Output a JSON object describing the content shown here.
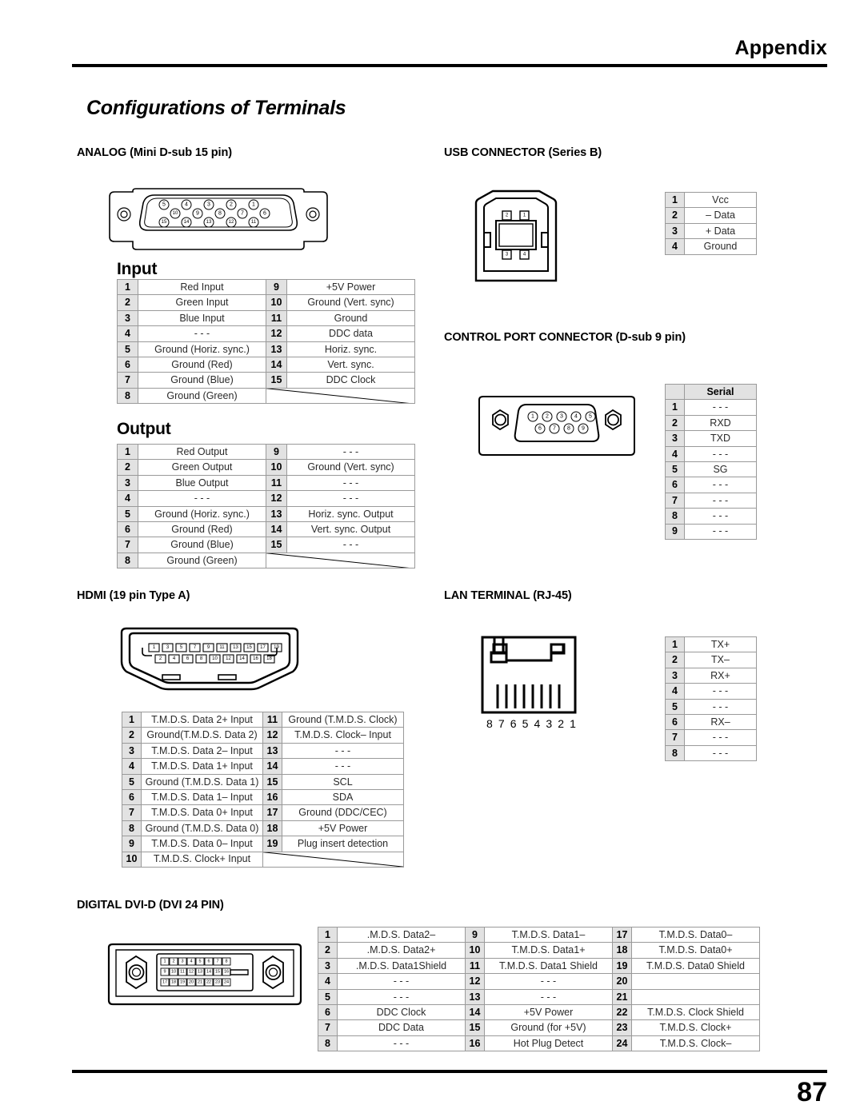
{
  "header": {
    "appendix_title": "Appendix",
    "section_title": "Configurations of Terminals",
    "page_number": "87"
  },
  "sections": {
    "analog": {
      "heading": "ANALOG (Mini D-sub 15 pin)"
    },
    "usb": {
      "heading": "USB CONNECTOR (Series B)"
    },
    "control_port": {
      "heading": "CONTROL PORT CONNECTOR (D-sub 9 pin)"
    },
    "hdmi": {
      "heading": "HDMI (19 pin Type A)"
    },
    "lan": {
      "heading": "LAN TERMINAL (RJ-45)"
    },
    "dvi": {
      "heading": "DIGITAL DVI-D (DVI 24 PIN)"
    }
  },
  "analog_input": {
    "title": "Input",
    "left": [
      {
        "pin": "1",
        "signal": "Red Input"
      },
      {
        "pin": "2",
        "signal": "Green Input"
      },
      {
        "pin": "3",
        "signal": "Blue Input"
      },
      {
        "pin": "4",
        "signal": "- - -"
      },
      {
        "pin": "5",
        "signal": "Ground (Horiz. sync.)"
      },
      {
        "pin": "6",
        "signal": "Ground (Red)"
      },
      {
        "pin": "7",
        "signal": "Ground (Blue)"
      },
      {
        "pin": "8",
        "signal": "Ground (Green)"
      }
    ],
    "right": [
      {
        "pin": "9",
        "signal": "+5V Power"
      },
      {
        "pin": "10",
        "signal": "Ground (Vert. sync)"
      },
      {
        "pin": "11",
        "signal": "Ground"
      },
      {
        "pin": "12",
        "signal": "DDC data"
      },
      {
        "pin": "13",
        "signal": "Horiz. sync."
      },
      {
        "pin": "14",
        "signal": "Vert. sync."
      },
      {
        "pin": "15",
        "signal": "DDC Clock"
      }
    ]
  },
  "analog_output": {
    "title": "Output",
    "left": [
      {
        "pin": "1",
        "signal": "Red Output"
      },
      {
        "pin": "2",
        "signal": "Green Output"
      },
      {
        "pin": "3",
        "signal": "Blue Output"
      },
      {
        "pin": "4",
        "signal": "- - -"
      },
      {
        "pin": "5",
        "signal": "Ground (Horiz. sync.)"
      },
      {
        "pin": "6",
        "signal": "Ground (Red)"
      },
      {
        "pin": "7",
        "signal": "Ground (Blue)"
      },
      {
        "pin": "8",
        "signal": "Ground (Green)"
      }
    ],
    "right": [
      {
        "pin": "9",
        "signal": "- - -"
      },
      {
        "pin": "10",
        "signal": "Ground (Vert. sync)"
      },
      {
        "pin": "11",
        "signal": "- - -"
      },
      {
        "pin": "12",
        "signal": "- - -"
      },
      {
        "pin": "13",
        "signal": "Horiz. sync. Output"
      },
      {
        "pin": "14",
        "signal": "Vert. sync. Output"
      },
      {
        "pin": "15",
        "signal": "- - -"
      }
    ]
  },
  "usb_table": {
    "rows": [
      {
        "pin": "1",
        "signal": "Vcc"
      },
      {
        "pin": "2",
        "signal": "– Data"
      },
      {
        "pin": "3",
        "signal": "+ Data"
      },
      {
        "pin": "4",
        "signal": "Ground"
      }
    ]
  },
  "control_table": {
    "header": "Serial",
    "rows": [
      {
        "pin": "1",
        "signal": "- - -"
      },
      {
        "pin": "2",
        "signal": "RXD"
      },
      {
        "pin": "3",
        "signal": "TXD"
      },
      {
        "pin": "4",
        "signal": "- - -"
      },
      {
        "pin": "5",
        "signal": "SG"
      },
      {
        "pin": "6",
        "signal": "- - -"
      },
      {
        "pin": "7",
        "signal": "- - -"
      },
      {
        "pin": "8",
        "signal": "- - -"
      },
      {
        "pin": "9",
        "signal": "- - -"
      }
    ]
  },
  "lan_table": {
    "rows": [
      {
        "pin": "1",
        "signal": "TX+"
      },
      {
        "pin": "2",
        "signal": "TX–"
      },
      {
        "pin": "3",
        "signal": "RX+"
      },
      {
        "pin": "4",
        "signal": "- - -"
      },
      {
        "pin": "5",
        "signal": "- - -"
      },
      {
        "pin": "6",
        "signal": "RX–"
      },
      {
        "pin": "7",
        "signal": "- - -"
      },
      {
        "pin": "8",
        "signal": "- - -"
      }
    ]
  },
  "hdmi_table": {
    "left": [
      {
        "pin": "1",
        "signal": "T.M.D.S. Data 2+ Input"
      },
      {
        "pin": "2",
        "signal": "Ground(T.M.D.S. Data 2)"
      },
      {
        "pin": "3",
        "signal": "T.M.D.S. Data 2– Input"
      },
      {
        "pin": "4",
        "signal": "T.M.D.S. Data 1+ Input"
      },
      {
        "pin": "5",
        "signal": "Ground (T.M.D.S. Data 1)"
      },
      {
        "pin": "6",
        "signal": "T.M.D.S. Data 1– Input"
      },
      {
        "pin": "7",
        "signal": "T.M.D.S. Data 0+ Input"
      },
      {
        "pin": "8",
        "signal": "Ground (T.M.D.S. Data 0)"
      },
      {
        "pin": "9",
        "signal": "T.M.D.S. Data 0– Input"
      },
      {
        "pin": "10",
        "signal": "T.M.D.S. Clock+ Input"
      }
    ],
    "right": [
      {
        "pin": "11",
        "signal": "Ground (T.M.D.S. Clock)"
      },
      {
        "pin": "12",
        "signal": "T.M.D.S. Clock– Input"
      },
      {
        "pin": "13",
        "signal": "- - -"
      },
      {
        "pin": "14",
        "signal": "- - -"
      },
      {
        "pin": "15",
        "signal": "SCL"
      },
      {
        "pin": "16",
        "signal": "SDA"
      },
      {
        "pin": "17",
        "signal": "Ground (DDC/CEC)"
      },
      {
        "pin": "18",
        "signal": "+5V Power"
      },
      {
        "pin": "19",
        "signal": "Plug insert detection"
      }
    ]
  },
  "dvi_table": {
    "col1": [
      {
        "pin": "1",
        "signal": ".M.D.S. Data2–"
      },
      {
        "pin": "2",
        "signal": ".M.D.S. Data2+"
      },
      {
        "pin": "3",
        "signal": ".M.D.S. Data1Shield"
      },
      {
        "pin": "4",
        "signal": "- - -"
      },
      {
        "pin": "5",
        "signal": "- - -"
      },
      {
        "pin": "6",
        "signal": "DDC Clock"
      },
      {
        "pin": "7",
        "signal": "DDC Data"
      },
      {
        "pin": "8",
        "signal": "- - -"
      }
    ],
    "col2": [
      {
        "pin": "9",
        "signal": "T.M.D.S. Data1–"
      },
      {
        "pin": "10",
        "signal": "T.M.D.S. Data1+"
      },
      {
        "pin": "11",
        "signal": "T.M.D.S. Data1 Shield"
      },
      {
        "pin": "12",
        "signal": "- - -"
      },
      {
        "pin": "13",
        "signal": "- - -"
      },
      {
        "pin": "14",
        "signal": "+5V Power"
      },
      {
        "pin": "15",
        "signal": "Ground (for +5V)"
      },
      {
        "pin": "16",
        "signal": "Hot Plug Detect"
      }
    ],
    "col3": [
      {
        "pin": "17",
        "signal": "T.M.D.S. Data0–"
      },
      {
        "pin": "18",
        "signal": "T.M.D.S. Data0+"
      },
      {
        "pin": "19",
        "signal": "T.M.D.S. Data0 Shield"
      },
      {
        "pin": "20",
        "signal": ""
      },
      {
        "pin": "21",
        "signal": ""
      },
      {
        "pin": "22",
        "signal": "T.M.D.S. Clock Shield"
      },
      {
        "pin": "23",
        "signal": "T.M.D.S. Clock+"
      },
      {
        "pin": "24",
        "signal": "T.M.D.S. Clock–"
      }
    ]
  },
  "diagrams": {
    "vga_pins": {
      "row_top": [
        "5",
        "4",
        "3",
        "2",
        "1"
      ],
      "row_mid": [
        "10",
        "9",
        "8",
        "7",
        "6"
      ],
      "row_bottom": [
        "15",
        "14",
        "13",
        "12",
        "11"
      ]
    },
    "usb_pins": {
      "top": [
        "2",
        "1"
      ],
      "bottom": [
        "3",
        "4"
      ]
    },
    "dsub9_pins": {
      "top": [
        "1",
        "2",
        "3",
        "4",
        "5"
      ],
      "bottom": [
        "6",
        "7",
        "8",
        "9"
      ]
    },
    "hdmi_pins": {
      "top": [
        "1",
        "3",
        "5",
        "7",
        "9",
        "11",
        "13",
        "15",
        "17",
        "19"
      ],
      "bottom": [
        "2",
        "4",
        "6",
        "8",
        "10",
        "12",
        "14",
        "16",
        "18"
      ]
    },
    "rj45_numbers": "8 7 6 5 4 3 2 1",
    "dvi_pins": {
      "row1": [
        "1",
        "2",
        "3",
        "4",
        "5",
        "6",
        "7",
        "8"
      ],
      "row2": [
        "9",
        "10",
        "11",
        "12",
        "13",
        "14",
        "15",
        "16"
      ],
      "row3": [
        "17",
        "18",
        "19",
        "20",
        "21",
        "22",
        "23",
        "24"
      ]
    }
  }
}
